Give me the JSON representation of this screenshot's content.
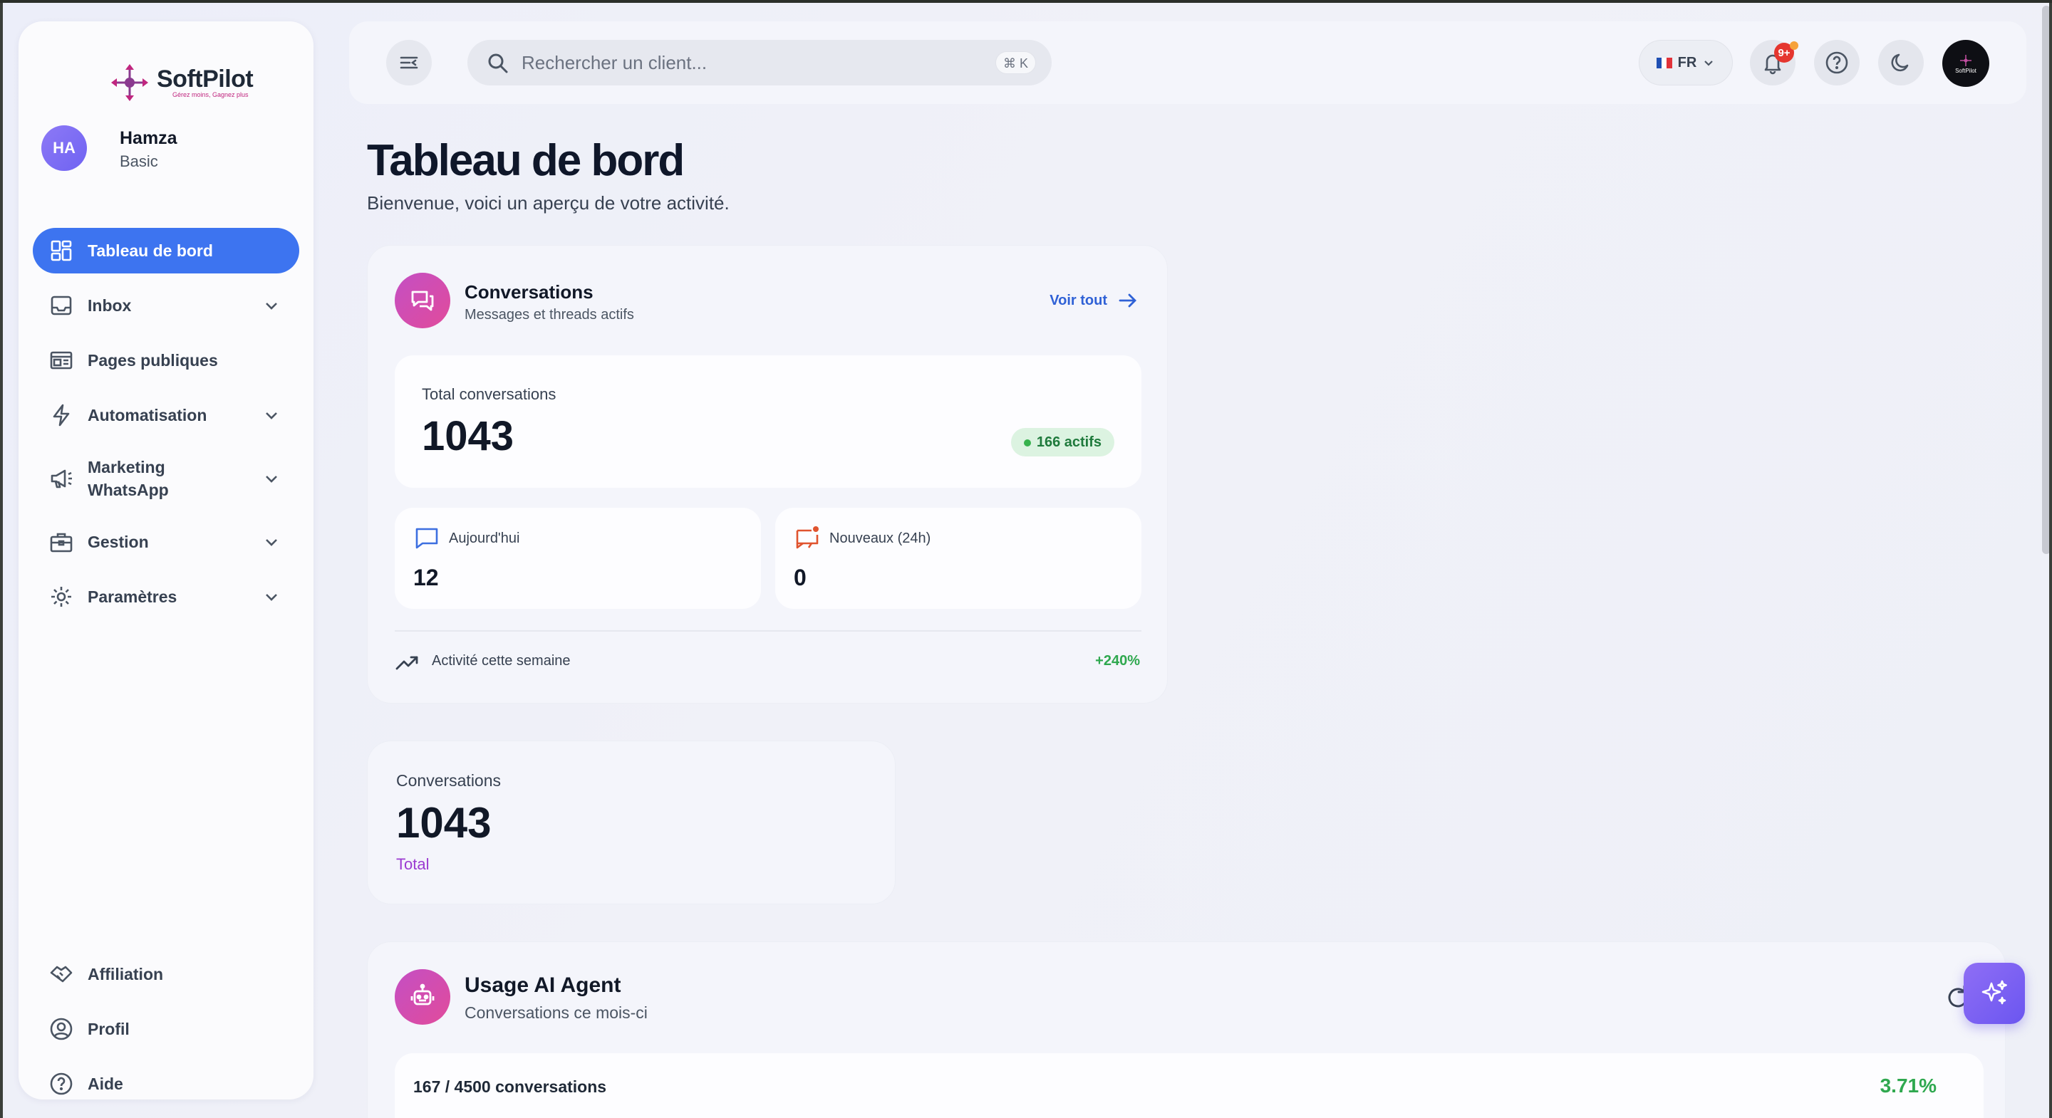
{
  "brand": {
    "name": "SoftPilot",
    "tagline": "Gérez moins, Gagnez plus"
  },
  "user": {
    "initials": "HA",
    "name": "Hamza",
    "plan": "Basic"
  },
  "sidebar": {
    "items": [
      {
        "label": "Tableau de bord",
        "icon": "dashboard-icon",
        "active": true,
        "expandable": false
      },
      {
        "label": "Inbox",
        "icon": "inbox-icon",
        "expandable": true
      },
      {
        "label": "Pages publiques",
        "icon": "web-page-icon",
        "expandable": false
      },
      {
        "label": "Automatisation",
        "icon": "lightning-icon",
        "expandable": true
      },
      {
        "label": "Marketing WhatsApp",
        "icon": "megaphone-icon",
        "expandable": true
      },
      {
        "label": "Gestion",
        "icon": "briefcase-icon",
        "expandable": true
      },
      {
        "label": "Paramètres",
        "icon": "gear-icon",
        "expandable": true
      }
    ],
    "bottom_items": [
      {
        "label": "Affiliation",
        "icon": "handshake-icon"
      },
      {
        "label": "Profil",
        "icon": "user-circle-icon"
      },
      {
        "label": "Aide",
        "icon": "help-circle-icon"
      }
    ]
  },
  "topbar": {
    "search_placeholder": "Rechercher un client...",
    "search_shortcut": "⌘ K",
    "language": "FR",
    "notification_count": "9+",
    "profile_mini_label": "SoftPilot"
  },
  "page": {
    "title": "Tableau de bord",
    "subtitle": "Bienvenue, voici un aperçu de votre activité."
  },
  "conversations_card": {
    "title": "Conversations",
    "subtitle": "Messages et threads actifs",
    "see_all": "Voir tout",
    "total_label": "Total conversations",
    "total_value": "1043",
    "active_badge": "166 actifs",
    "today_label": "Aujourd'hui",
    "today_value": "12",
    "new_label": "Nouveaux (24h)",
    "new_value": "0",
    "activity_label": "Activité cette semaine",
    "activity_value": "+240%"
  },
  "stat_card": {
    "label": "Conversations",
    "value": "1043",
    "sublabel": "Total"
  },
  "ai_card": {
    "title": "Usage AI Agent",
    "subtitle": "Conversations ce mois-ci",
    "usage_label": "167 / 4500 conversations",
    "usage_percent": "3.71%",
    "usage_fraction": 0.0371
  },
  "colors": {
    "accent": "#3d74f0",
    "positive": "#2fa84f",
    "brand_gradient_start": "#c44fc4",
    "brand_gradient_end": "#e14b9b"
  }
}
